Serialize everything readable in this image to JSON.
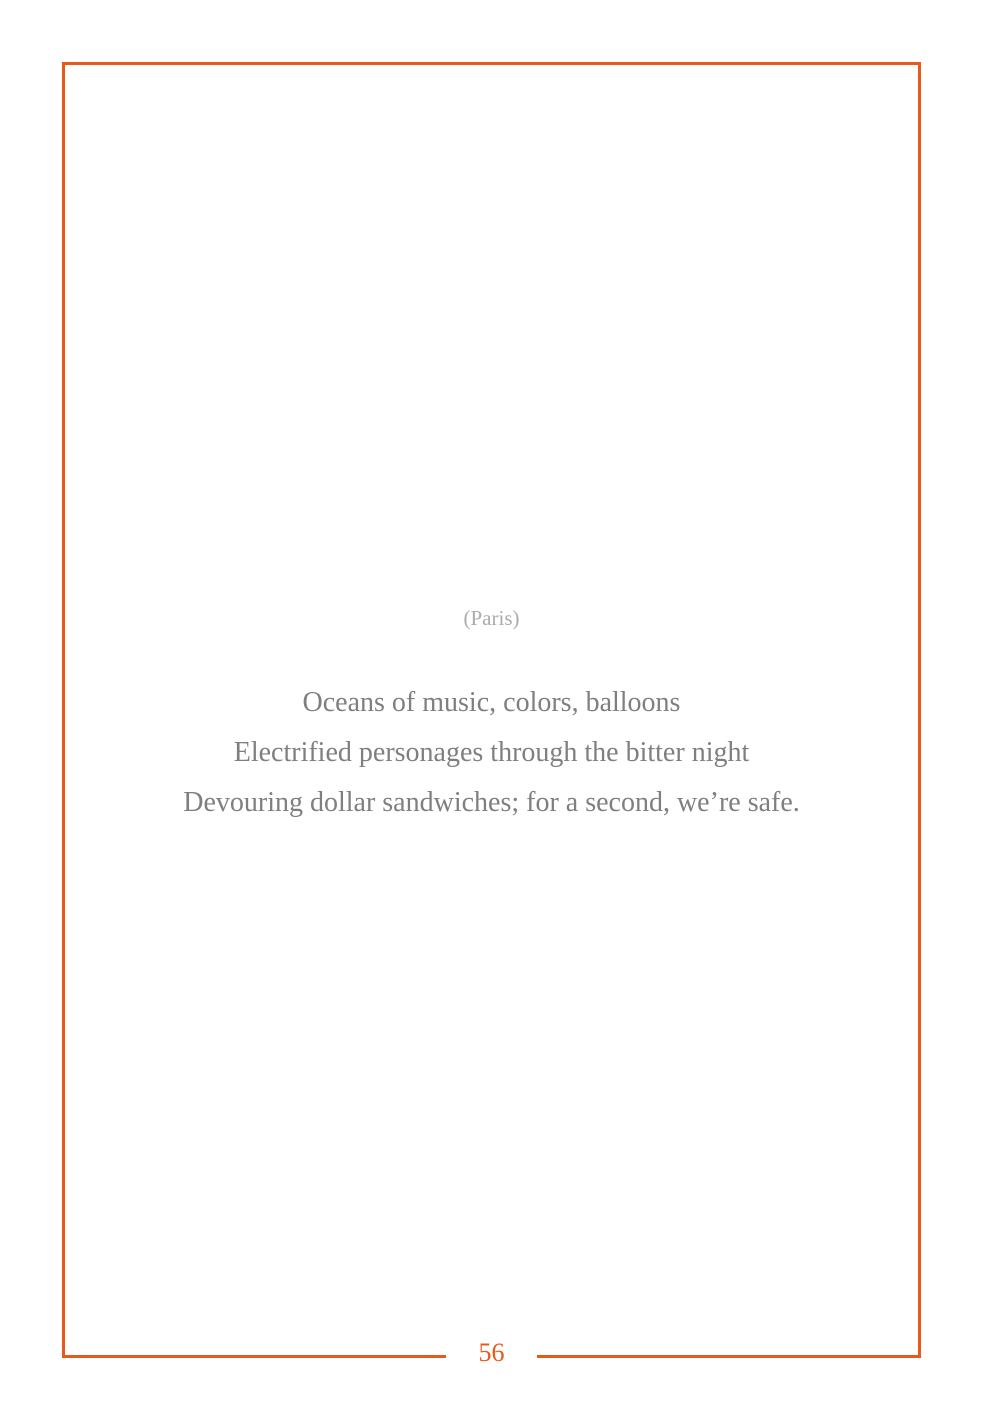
{
  "location": "(Paris)",
  "poem": {
    "lines": [
      "Oceans of music, colors, balloons",
      "Electrified personages through the bitter night",
      "Devouring dollar sandwiches; for a second, we’re safe."
    ]
  },
  "page_number": "56",
  "colors": {
    "frame": "#e9591c",
    "text": "#7f7f7f",
    "location_text": "#ababab"
  }
}
